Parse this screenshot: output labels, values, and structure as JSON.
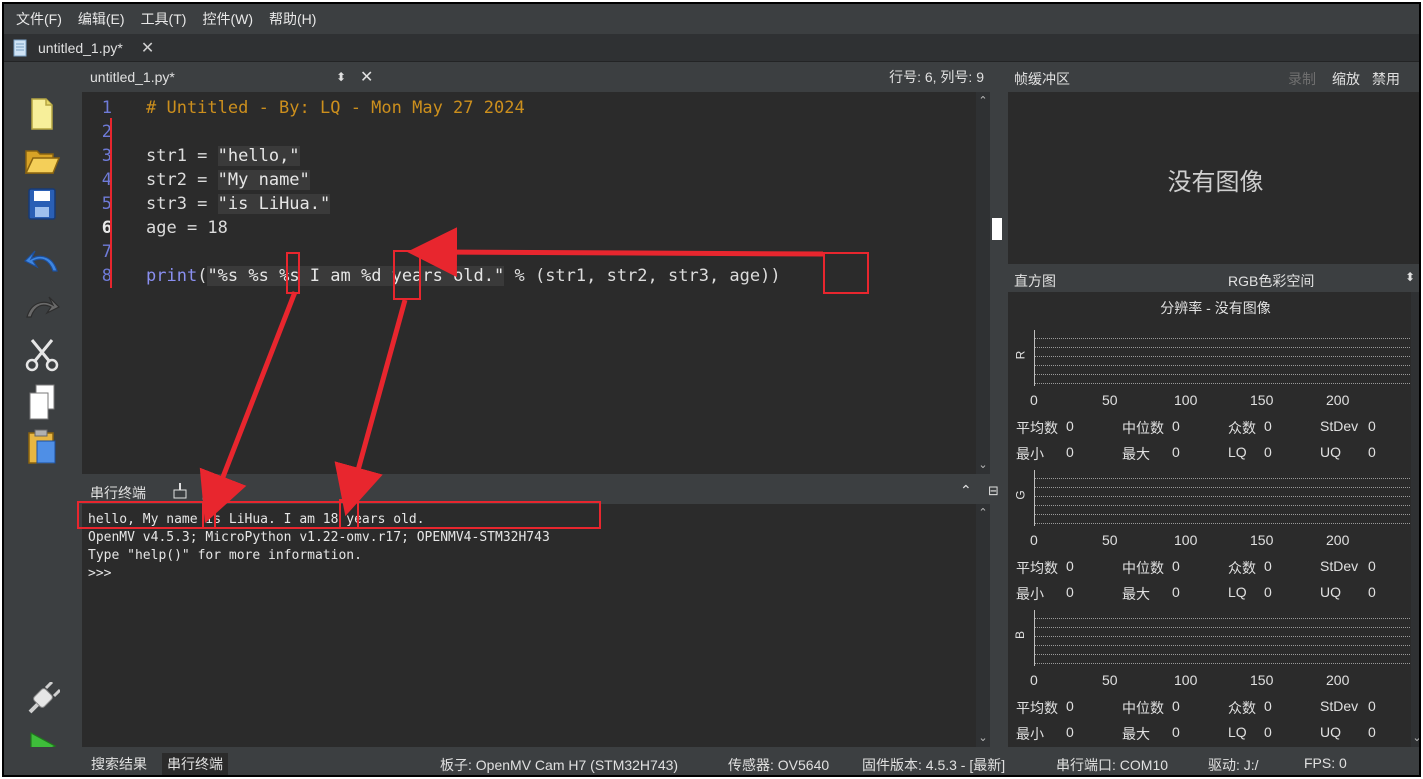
{
  "menu": [
    "文件(F)",
    "编辑(E)",
    "工具(T)",
    "控件(W)",
    "帮助(H)"
  ],
  "file_tab": {
    "name": "untitled_1.py*"
  },
  "toolbar_icons": [
    "new-file-icon",
    "open-folder-icon",
    "save-icon",
    "undo-icon",
    "redo-icon",
    "cut-icon",
    "copy-icon",
    "paste-icon",
    "connect-icon",
    "run-icon"
  ],
  "editor": {
    "filename": "untitled_1.py*",
    "cursor_pos": "行号: 6, 列号: 9",
    "line_numbers": [
      "1",
      "2",
      "3",
      "4",
      "5",
      "6",
      "7",
      "8"
    ],
    "lines": {
      "l1": "# Untitled - By: LQ - Mon May 27 2024",
      "l3a": "str1 = ",
      "l3b": "\"hello,\"",
      "l4a": "str2 = ",
      "l4b": "\"My name\"",
      "l5a": "str3 = ",
      "l5b": "\"is LiHua.\"",
      "l6": "age = 18",
      "l8a": "print",
      "l8b": "(",
      "l8c": "\"%s %s %s I am %d years old.\"",
      "l8d": " % (str1, str2, str3, age))"
    }
  },
  "terminal": {
    "title": "串行终端",
    "lines": [
      "hello, My name is LiHua. I am 18 years old.",
      "OpenMV v4.5.3; MicroPython v1.22-omv.r17; OPENMV4-STM32H743",
      "Type \"help()\" for more information.",
      ">>>"
    ]
  },
  "frame_buffer": {
    "title": "帧缓冲区",
    "buttons": {
      "record": "录制",
      "zoom": "缩放",
      "disable": "禁用"
    },
    "no_image": "没有图像"
  },
  "histogram": {
    "title": "直方图",
    "color_space": "RGB色彩空间",
    "resolution": "分辨率 - 没有图像",
    "channels": [
      {
        "label": "R"
      },
      {
        "label": "G"
      },
      {
        "label": "B"
      }
    ],
    "ticks": [
      "0",
      "50",
      "100",
      "150",
      "200"
    ],
    "stats": {
      "mean": "平均数",
      "median": "中位数",
      "mode": "众数",
      "stdev": "StDev",
      "min": "最小",
      "max": "最大",
      "lq": "LQ",
      "uq": "UQ",
      "zero": "0"
    }
  },
  "statusbar": {
    "tabs": [
      "搜索结果",
      "串行终端"
    ],
    "board": "板子: OpenMV Cam H7 (STM32H743)",
    "sensor": "传感器: OV5640",
    "firmware": "固件版本: 4.5.3 - [最新]",
    "port": "串行端口: COM10",
    "drive": "驱动: J:/",
    "fps": "FPS: 0"
  },
  "colors": {
    "background": "#2b2b2b",
    "panel": "#3c3f41",
    "annotation_red": "#e8262e",
    "comment": "#cc8f1d",
    "line_numbers": "#6f7bd8",
    "function": "#8a8ff0"
  }
}
